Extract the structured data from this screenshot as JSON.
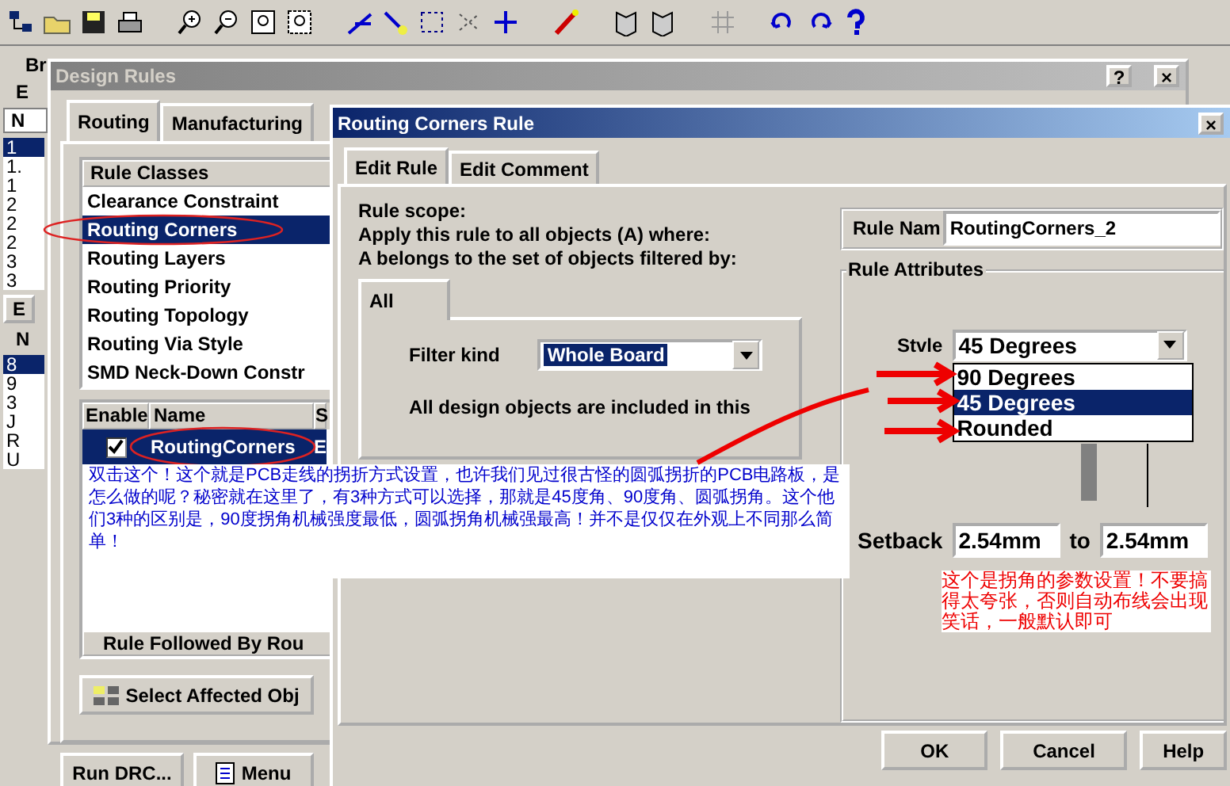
{
  "background_panel": {
    "title": "Br",
    "group_label": "E",
    "field_value": "N",
    "list_a": [
      {
        "label": "1",
        "selected": true
      },
      {
        "label": "1.",
        "selected": false
      },
      {
        "label": "1",
        "selected": false
      },
      {
        "label": "2",
        "selected": false
      },
      {
        "label": "2",
        "selected": false
      },
      {
        "label": "2",
        "selected": false
      },
      {
        "label": "3",
        "selected": false
      },
      {
        "label": "3",
        "selected": false
      }
    ],
    "button": "E",
    "label_b": "N",
    "list_b": [
      {
        "label": "8",
        "selected": true
      },
      {
        "label": "9",
        "selected": false
      },
      {
        "label": "3",
        "selected": false
      },
      {
        "label": "J",
        "selected": false
      },
      {
        "label": "R",
        "selected": false
      },
      {
        "label": "U",
        "selected": false
      }
    ]
  },
  "design_rules": {
    "title": "Design Rules",
    "title_buttons": [
      "?",
      "×"
    ],
    "tabs": [
      {
        "label": "Routing",
        "selected": true
      },
      {
        "label": "Manufacturing",
        "selected": false
      }
    ],
    "rule_classes": {
      "header": "Rule Classes",
      "items": [
        {
          "label": "Clearance Constraint",
          "selected": false
        },
        {
          "label": "Routing Corners",
          "selected": true
        },
        {
          "label": "Routing Layers",
          "selected": false
        },
        {
          "label": "Routing Priority",
          "selected": false
        },
        {
          "label": "Routing Topology",
          "selected": false
        },
        {
          "label": "Routing Via Style",
          "selected": false
        },
        {
          "label": "SMD Neck-Down Constr",
          "selected": false
        }
      ]
    },
    "rules_table": {
      "columns": [
        "Enable",
        "Name",
        "S"
      ],
      "rows": [
        {
          "enabled": true,
          "name": "RoutingCorners",
          "column_3": "E",
          "selected": true
        }
      ],
      "footer": "Rule Followed By Rou"
    },
    "select_button": "Select Affected Obj",
    "buttons": [
      "Run DRC...",
      "Menu"
    ]
  },
  "rule_dialog": {
    "title": "Routing Corners Rule",
    "title_button": "×",
    "tabs": [
      {
        "label": "Edit Rule",
        "selected": true
      },
      {
        "label": "Edit Comment",
        "selected": false
      }
    ],
    "scope_lines": [
      "Rule scope:",
      "Apply this rule to all objects (A) where:",
      "A belongs to the set of objects filtered by:"
    ],
    "filter": {
      "tab": "All",
      "label": "Filter kind",
      "value": "Whole Board",
      "description": "All design objects are included in this"
    },
    "rule_name": {
      "label": "Rule Nam",
      "value": "RoutingCorners_2"
    },
    "attributes": {
      "title": "Rule Attributes",
      "style_label": "Stvle",
      "style_value": "45 Degrees",
      "options": [
        {
          "label": "90 Degrees",
          "selected": false
        },
        {
          "label": "45 Degrees",
          "selected": true
        },
        {
          "label": "Rounded",
          "selected": false
        }
      ],
      "setback_label": "Setback",
      "setback_from": "2.54mm",
      "to_label": "to",
      "setback_to": "2.54mm"
    },
    "buttons": [
      "OK",
      "Cancel",
      "Help"
    ]
  },
  "annotations": {
    "blue_note": "双击这个！这个就是PCB走线的拐折方式设置，也许我们见过很古怪的圆弧拐折的PCB电路板，是怎么做的呢？秘密就在这里了，有3种方式可以选择，那就是45度角、90度角、圆弧拐角。这个他们3种的区别是，90度拐角机械强度最低，圆弧拐角机械强最高！并不是仅仅在外观上不同那么简单！",
    "red_note": "这个是拐角的参数设置！不要搞得太夸张，否则自动布线会出现笑话，一般默认即可"
  }
}
